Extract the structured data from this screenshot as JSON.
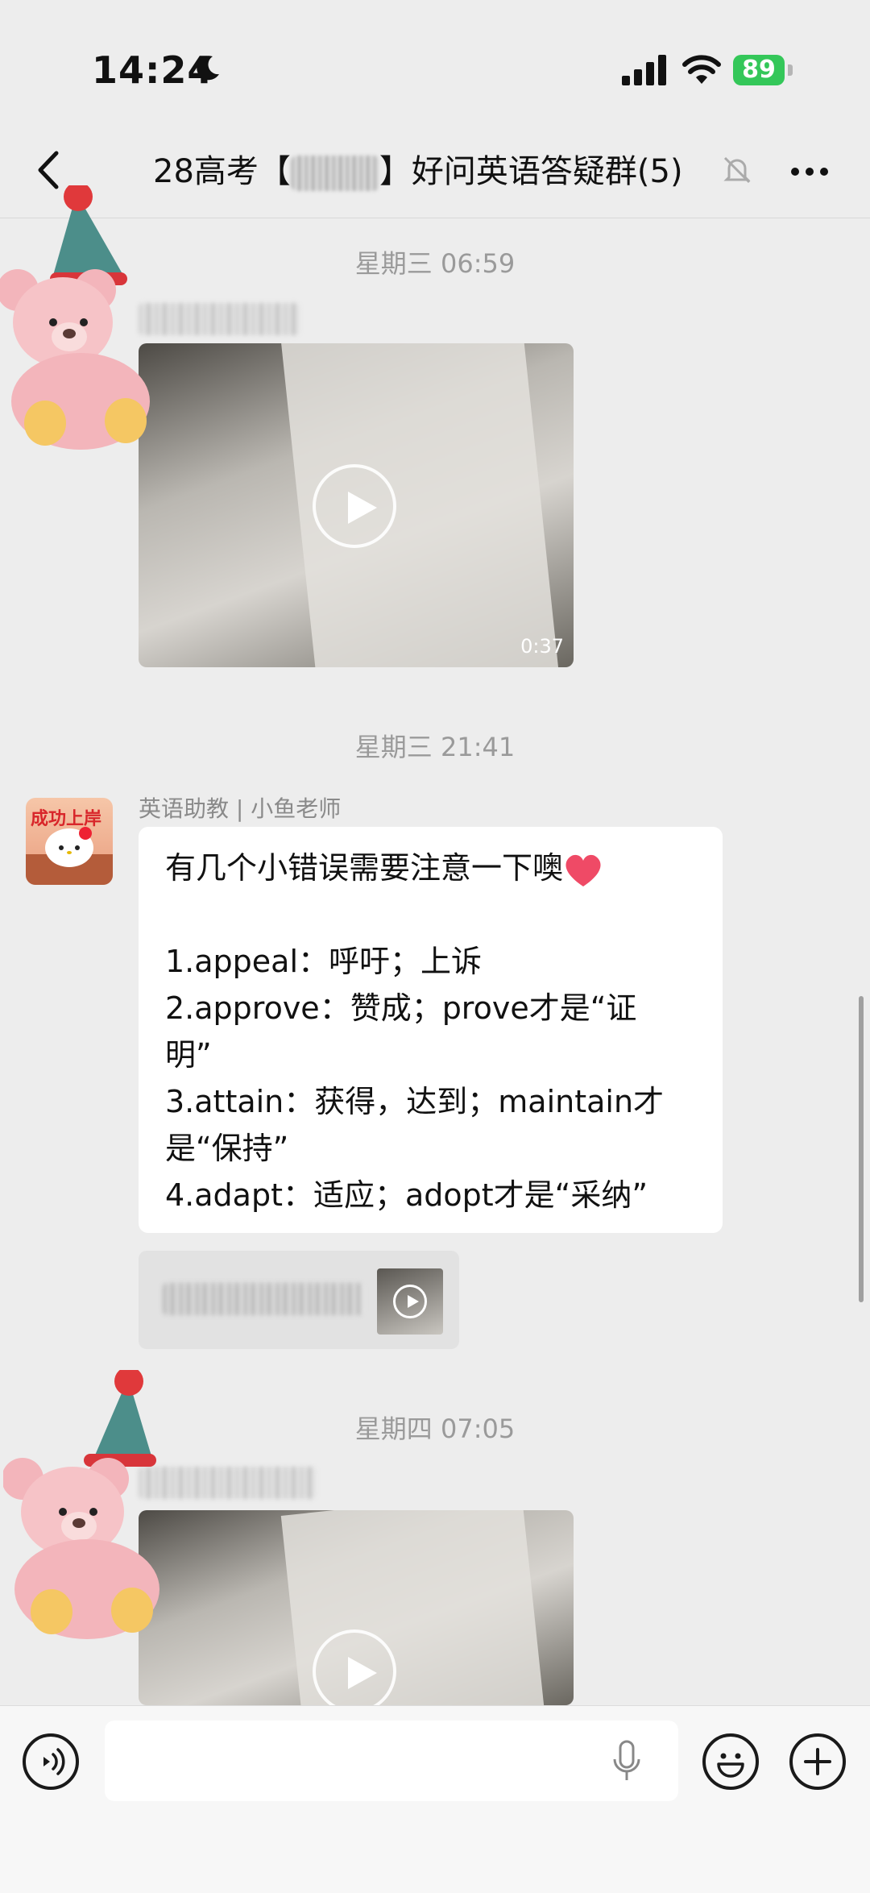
{
  "status_bar": {
    "time": "14:24",
    "battery": "89"
  },
  "header": {
    "title_prefix": "28高考【",
    "title_suffix": "】好问英语答疑群(5)"
  },
  "messages": [
    {
      "type": "timestamp",
      "text": "星期三 06:59"
    },
    {
      "type": "video",
      "duration": "0:37"
    },
    {
      "type": "timestamp",
      "text": "星期三 21:41"
    },
    {
      "type": "text",
      "sender": "英语助教 | 小鱼老师",
      "avatar_label": "成功上岸",
      "lines": [
        "有几个小错误需要注意一下噢",
        "",
        "1.appeal：呼吁；上诉",
        "2.approve：赞成；prove才是“证",
        "明”",
        "3.attain：获得，达到；maintain才",
        "是“保持”",
        "4.adapt：适应；adopt才是“采纳”"
      ]
    },
    {
      "type": "quote"
    },
    {
      "type": "timestamp",
      "text": "星期四 07:05"
    },
    {
      "type": "video"
    }
  ],
  "icons": {
    "back": "chevron-left-icon",
    "mute": "bell-slash-icon",
    "more": "ellipsis-icon",
    "voice": "voice-wave-icon",
    "mic": "microphone-icon",
    "emoji": "smile-icon",
    "plus": "plus-icon"
  },
  "colors": {
    "background": "#ededed",
    "battery": "#34c759",
    "bubble": "#ffffff"
  }
}
